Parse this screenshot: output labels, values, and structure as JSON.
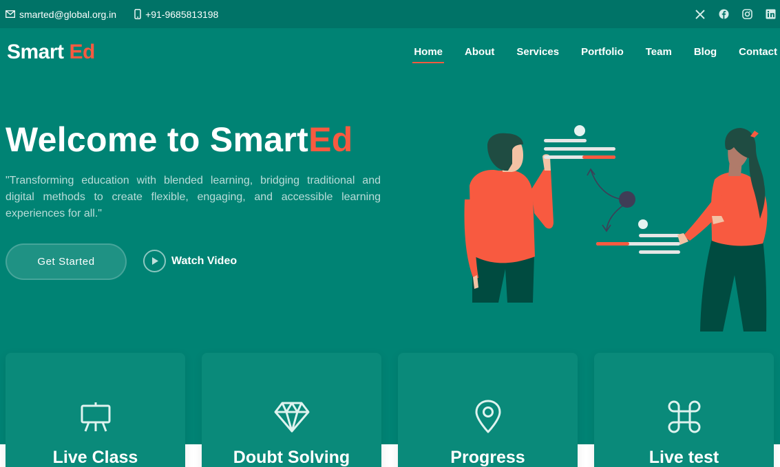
{
  "topbar": {
    "email": "smarted@global.org.in",
    "phone": "+91-9685813198",
    "socials": [
      "x-icon",
      "facebook-icon",
      "instagram-icon",
      "linkedin-icon"
    ]
  },
  "brand": {
    "name": "Smart",
    "accent": "Ed"
  },
  "nav": {
    "items": [
      {
        "label": "Home",
        "active": true
      },
      {
        "label": "About"
      },
      {
        "label": "Services"
      },
      {
        "label": "Portfolio"
      },
      {
        "label": "Team"
      },
      {
        "label": "Blog"
      },
      {
        "label": "Contact"
      }
    ]
  },
  "hero": {
    "title_main": "Welcome to Smart",
    "title_accent": "Ed",
    "description": "\"Transforming education with blended learning, bridging traditional and digital methods to create flexible, engaging, and accessible learning experiences for all.\"",
    "cta_label": "Get Started",
    "video_label": "Watch Video"
  },
  "cards": [
    {
      "title": "Live Class",
      "icon": "easel-icon"
    },
    {
      "title": "Doubt Solving",
      "icon": "diamond-icon"
    },
    {
      "title": "Progress",
      "icon": "location-pin-icon"
    },
    {
      "title": "Live test",
      "icon": "command-icon"
    }
  ],
  "colors": {
    "topbar_bg": "#007367",
    "hero_bg": "#008374",
    "accent": "#f85a40",
    "card_bg": "#0a8a7a"
  }
}
